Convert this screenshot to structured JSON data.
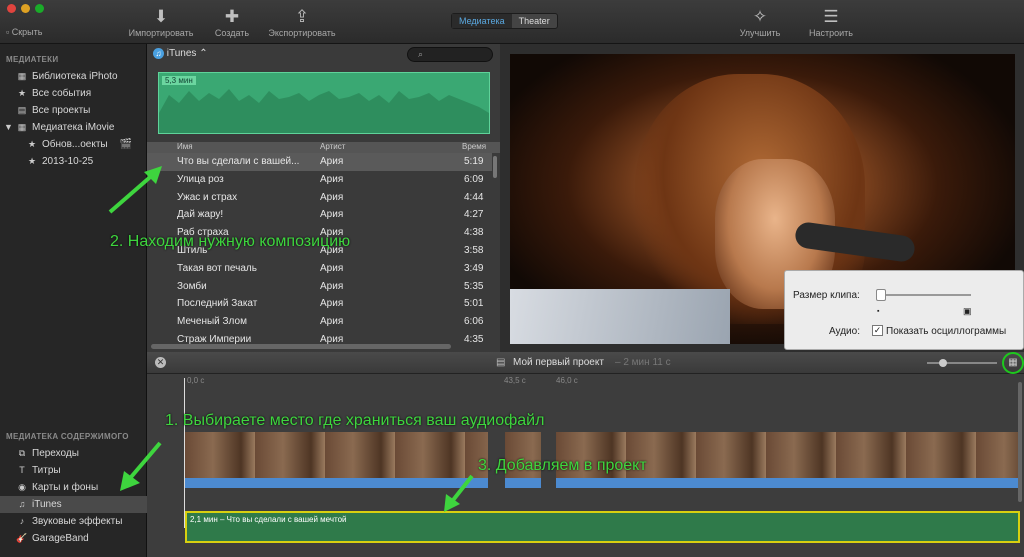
{
  "toolbar": {
    "hide": "Скрыть",
    "import": "Импортировать",
    "create": "Создать",
    "export": "Экспортировать",
    "improve": "Улучшить",
    "settings": "Настроить",
    "tabs": [
      "Медиатека",
      "Theater"
    ]
  },
  "sidebar": {
    "header1": "МЕДИАТЕКИ",
    "items1": [
      {
        "icon": "photo-library-icon",
        "label": "Библиотека iPhoto"
      },
      {
        "icon": "events-icon",
        "label": "Все события"
      },
      {
        "icon": "projects-icon",
        "label": "Все проекты"
      },
      {
        "icon": "imovie-library-icon",
        "label": "Медиатека iMovie"
      },
      {
        "icon": "star-icon",
        "label": "Обнов...оекты"
      },
      {
        "icon": "star-icon",
        "label": "2013-10-25"
      }
    ],
    "header2": "МЕДИАТЕКА СОДЕРЖИМОГО",
    "items2": [
      {
        "icon": "transitions-icon",
        "label": "Переходы"
      },
      {
        "icon": "titles-icon",
        "label": "Титры"
      },
      {
        "icon": "maps-icon",
        "label": "Карты и фоны"
      },
      {
        "icon": "itunes-icon",
        "label": "iTunes"
      },
      {
        "icon": "sound-effects-icon",
        "label": "Звуковые эффекты"
      },
      {
        "icon": "garageband-icon",
        "label": "GarageBand"
      }
    ]
  },
  "browser": {
    "source": "iTunes",
    "duration_badge": "5,3 мин",
    "columns": [
      "Имя",
      "Артист",
      "Время"
    ],
    "rows": [
      [
        "Что вы сделали с вашей...",
        "Ария",
        "5:19"
      ],
      [
        "Улица роз",
        "Ария",
        "6:09"
      ],
      [
        "Ужас и страх",
        "Ария",
        "4:44"
      ],
      [
        "Дай жару!",
        "Ария",
        "4:27"
      ],
      [
        "Раб страха",
        "Ария",
        "4:38"
      ],
      [
        "Штиль",
        "Ария",
        "3:58"
      ],
      [
        "Такая вот печаль",
        "Ария",
        "3:49"
      ],
      [
        "Зомби",
        "Ария",
        "5:35"
      ],
      [
        "Последний Закат",
        "Ария",
        "5:01"
      ],
      [
        "Меченый Злом",
        "Ария",
        "6:06"
      ],
      [
        "Страж Империи",
        "Ария",
        "4:35"
      ]
    ]
  },
  "popover": {
    "clip_size_label": "Размер клипа:",
    "audio_label": "Аудио:",
    "waveform_checkbox": "Показать осциллограммы"
  },
  "timeline": {
    "project_title": "Мой первый проект",
    "project_duration": "– 2 мин 11 с",
    "markers": [
      "0,0 с",
      "43,5 с",
      "46,0 с"
    ],
    "music_clip": "2,1 мин – Что вы сделали с вашей мечтой"
  },
  "annotations": {
    "step1": "1. Выбираете место где храниться ваш аудиофайл",
    "step2": "2. Находим нужную композицию",
    "step3": "3. Добавляем в проект"
  },
  "colors": {
    "annotation": "#3ed53e",
    "selection": "#4a4a4a",
    "music_border": "#d8d010"
  }
}
